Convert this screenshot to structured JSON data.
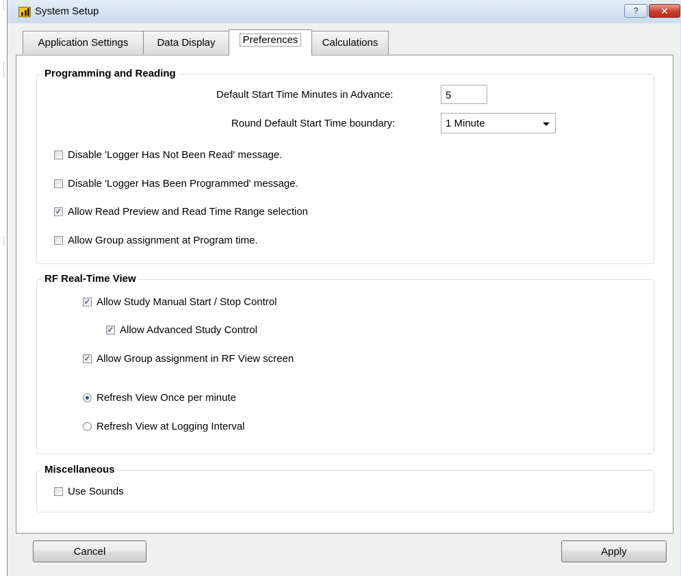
{
  "window": {
    "title": "System Setup",
    "help_glyph": "?",
    "close_glyph": "✕"
  },
  "tabs": [
    {
      "label": "Application Settings",
      "active": false
    },
    {
      "label": "Data Display",
      "active": false
    },
    {
      "label": "Preferences",
      "active": true
    },
    {
      "label": "Calculations",
      "active": false
    }
  ],
  "programming": {
    "title": "Programming and Reading",
    "start_minutes_label": "Default Start Time Minutes in Advance:",
    "start_minutes_value": "5",
    "round_label": "Round Default Start Time boundary:",
    "round_value": "1 Minute",
    "checkboxes": [
      {
        "label": "Disable 'Logger Has Not Been Read' message.",
        "checked": false
      },
      {
        "label": "Disable 'Logger Has Been Programmed' message.",
        "checked": false
      },
      {
        "label": "Allow Read Preview and Read Time Range selection",
        "checked": true
      },
      {
        "label": "Allow Group assignment at Program time.",
        "checked": false
      }
    ]
  },
  "rf_view": {
    "title": "RF Real-Time View",
    "checkboxes": [
      {
        "label": "Allow Study Manual Start / Stop Control",
        "checked": true
      },
      {
        "label": "Allow Advanced Study Control",
        "checked": true
      },
      {
        "label": "Allow Group assignment in RF View screen",
        "checked": true
      }
    ],
    "radios": [
      {
        "label": "Refresh View Once per minute",
        "selected": true
      },
      {
        "label": "Refresh View at Logging Interval",
        "selected": false
      }
    ]
  },
  "misc": {
    "title": "Miscellaneous",
    "checkboxes": [
      {
        "label": "Use Sounds",
        "checked": false
      }
    ]
  },
  "buttons": {
    "cancel": "Cancel",
    "apply": "Apply"
  },
  "colors": {
    "titlebar": "#cbdcee",
    "close_button": "#c8402b",
    "check_mark": "#21396a"
  }
}
